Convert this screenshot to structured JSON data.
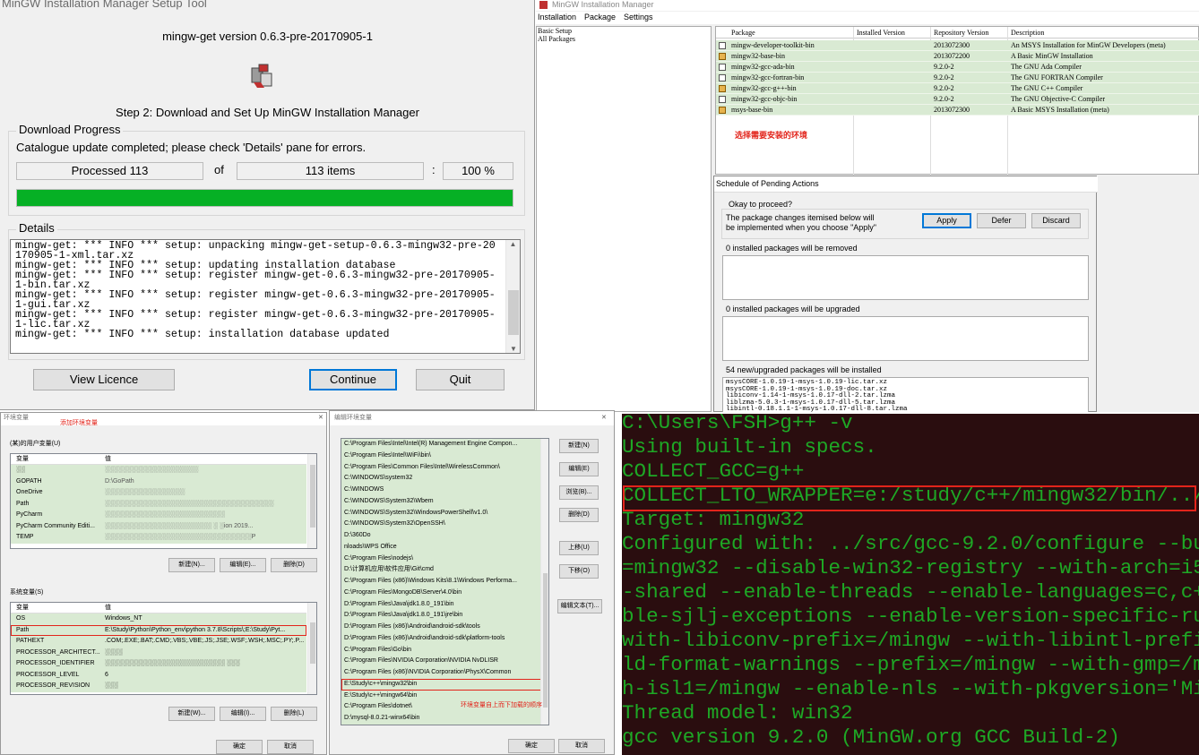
{
  "setup": {
    "title": "MinGW Installation Manager Setup Tool",
    "version": "mingw-get version 0.6.3-pre-20170905-1",
    "step": "Step 2: Download and Set Up MinGW Installation Manager",
    "download_group": "Download Progress",
    "status": "Catalogue update completed; please check 'Details' pane for errors.",
    "processed": "Processed 113",
    "of": "of",
    "items": "113 items",
    "colon": ":",
    "percent": "100 %",
    "progress_fraction": 1.0,
    "details_group": "Details",
    "details_text": "mingw-get: *** INFO *** setup: unpacking mingw-get-setup-0.6.3-mingw32-pre-20\n170905-1-xml.tar.xz\nmingw-get: *** INFO *** setup: updating installation database\nmingw-get: *** INFO *** setup: register mingw-get-0.6.3-mingw32-pre-20170905-\n1-bin.tar.xz\nmingw-get: *** INFO *** setup: register mingw-get-0.6.3-mingw32-pre-20170905-\n1-gui.tar.xz\nmingw-get: *** INFO *** setup: register mingw-get-0.6.3-mingw32-pre-20170905-\n1-lic.tar.xz\nmingw-get: *** INFO *** setup: installation database updated",
    "buttons": {
      "licence": "View Licence",
      "continue": "Continue",
      "quit": "Quit"
    },
    "progress_color": "#06b025"
  },
  "manager": {
    "title": "MinGW Installation Manager",
    "menu": [
      "Installation",
      "Package",
      "Settings"
    ],
    "tree": [
      "Basic Setup",
      "All Packages"
    ],
    "columns": [
      "Package",
      "Installed Version",
      "Repository Version",
      "Description"
    ],
    "packages": [
      {
        "name": "mingw-developer-toolkit-bin",
        "installed": "",
        "repo": "2013072300",
        "desc": "An MSYS Installation for MinGW Developers (meta)",
        "marked": false
      },
      {
        "name": "mingw32-base-bin",
        "installed": "",
        "repo": "2013072200",
        "desc": "A Basic MinGW Installation",
        "marked": true
      },
      {
        "name": "mingw32-gcc-ada-bin",
        "installed": "",
        "repo": "9.2.0-2",
        "desc": "The GNU Ada Compiler",
        "marked": false
      },
      {
        "name": "mingw32-gcc-fortran-bin",
        "installed": "",
        "repo": "9.2.0-2",
        "desc": "The GNU FORTRAN Compiler",
        "marked": false
      },
      {
        "name": "mingw32-gcc-g++-bin",
        "installed": "",
        "repo": "9.2.0-2",
        "desc": "The GNU C++ Compiler",
        "marked": true
      },
      {
        "name": "mingw32-gcc-objc-bin",
        "installed": "",
        "repo": "9.2.0-2",
        "desc": "The GNU Objective-C Compiler",
        "marked": false
      },
      {
        "name": "msys-base-bin",
        "installed": "",
        "repo": "2013072300",
        "desc": "A Basic MSYS Installation (meta)",
        "marked": true
      }
    ],
    "annotation": "选择需要安装的环境",
    "row_color": "#d9ead3",
    "annotation_color": "#e2241b"
  },
  "pending": {
    "title": "Schedule of Pending Actions",
    "okay_group": "Okay to proceed?",
    "msg_line1": "The package changes itemised below will",
    "msg_line2": "be implemented when you choose \"Apply\"",
    "buttons": {
      "apply": "Apply",
      "defer": "Defer",
      "discard": "Discard"
    },
    "removed": "0 installed packages will be removed",
    "upgraded": "0 installed packages will be upgraded",
    "installed": "54 new/upgraded packages will be installed",
    "install_list": [
      "msysCORE-1.0.19-1-msys-1.0.19-lic.tar.xz",
      "msysCORE-1.0.19-1-msys-1.0.19-doc.tar.xz",
      "libiconv-1.14-1-msys-1.0.17-dll-2.tar.lzma",
      "liblzma-5.0.3-1-msys-1.0.17-dll-5.tar.lzma",
      "libintl-0.18.1.1-1-msys-1.0.17-dll-8.tar.lzma"
    ]
  },
  "envvars": {
    "title": "环境变量",
    "annotation": "添加环境变量",
    "user_group": "(某)的用户变量(U)",
    "user_headers": [
      "变量",
      "值"
    ],
    "user_vars": [
      {
        "name": "░░",
        "value": "░░░░░░░░░░░░░░░░░░░░░"
      },
      {
        "name": "GOPATH",
        "value": "D:\\GoPath"
      },
      {
        "name": "OneDrive",
        "value": "░░░░░░░░░░░░░░░░░░"
      },
      {
        "name": "Path",
        "value": "░░░░░░░░░░░░░░░░░░░░░░░░░░░░░░░░░░░░░░"
      },
      {
        "name": "PyCharm",
        "value": "░░░░░░░░░░░░░░░░░░░░░░░░░░░"
      },
      {
        "name": "PyCharm Community Editi...",
        "value": "░░░░░░░░░░░░░░░░░░░░░░░░ ░ ░ion 2019..."
      },
      {
        "name": "TEMP",
        "value": "░░░░░░░░░░░░░░░░░░░░░░░░░░░░░░░░░P"
      }
    ],
    "user_buttons": [
      "新建(N)...",
      "编辑(E)...",
      "删除(D)"
    ],
    "system_group": "系统变量(S)",
    "sys_headers": [
      "变量",
      "值"
    ],
    "sys_vars": [
      {
        "name": "OS",
        "value": "Windows_NT",
        "hl": false
      },
      {
        "name": "Path",
        "value": "E:\\Study\\Python\\Python_env\\python 3.7.8\\Scripts\\;E:\\Study\\Pyt...",
        "hl": true
      },
      {
        "name": "PATHEXT",
        "value": ".COM;.EXE;.BAT;.CMD;.VBS;.VBE;.JS;.JSE;.WSF;.WSH;.MSC;.PY;.P...",
        "hl": false
      },
      {
        "name": "PROCESSOR_ARCHITECT...",
        "value": "░░░░",
        "hl": false
      },
      {
        "name": "PROCESSOR_IDENTIFIER",
        "value": "░░░░░░░░░░░░░░░░░░░░░░░░░░░ ░░░",
        "hl": false
      },
      {
        "name": "PROCESSOR_LEVEL",
        "value": "6",
        "hl": false
      },
      {
        "name": "PROCESSOR_REVISION",
        "value": "░░░",
        "hl": false
      }
    ],
    "sys_buttons": [
      "新建(W)...",
      "编辑(I)...",
      "删除(L)"
    ],
    "bottom_buttons": [
      "确定",
      "取消"
    ]
  },
  "editenv": {
    "title": "编辑环境变量",
    "paths": [
      "C:\\Program Files\\Intel\\Intel(R) Management Engine Compon...",
      "C:\\Program Files\\Intel\\WiFi\\bin\\",
      "C:\\Program Files\\Common Files\\Intel\\WirelessCommon\\",
      "C:\\WINDOWS\\system32",
      "C:\\WINDOWS",
      "C:\\WINDOWS\\System32\\Wbem",
      "C:\\WINDOWS\\System32\\WindowsPowerShell\\v1.0\\",
      "C:\\WINDOWS\\System32\\OpenSSH\\",
      "D:\\360Do",
      "nloads\\WPS Office",
      "C:\\Program Files\\nodejs\\",
      "D:\\计算机应用\\软件应用\\Git\\cmd",
      "C:\\Program Files (x86)\\Windows Kits\\8.1\\Windows Performa...",
      "C:\\Program Files\\MongoDB\\Server\\4.0\\bin",
      "D:\\Program Files\\Java\\jdk1.8.0_191\\bin",
      "D:\\Program Files\\Java\\jdk1.8.0_191\\jre\\bin",
      "D:\\Program Files (x86)\\Android\\android-sdk\\tools",
      "D:\\Program Files (x86)\\Android\\android-sdk\\platform-tools",
      "C:\\Program Files\\Go\\bin",
      "C:\\Program Files\\NVIDIA Corporation\\NVIDIA NvDLISR",
      "C:\\Program Files (x86)\\NVIDIA Corporation\\PhysX\\Common",
      "E:\\Study\\c++\\mingw32\\bin",
      "E:\\Study\\c++\\mingw64\\bin",
      "C:\\Program Files\\dotnet\\",
      "D:\\mysql-8.0.21-winx64\\bin"
    ],
    "highlight_index": 21,
    "buttons": [
      "新建(N)",
      "编辑(E)",
      "浏览(B)...",
      "删除(D)",
      "上移(U)",
      "下移(O)",
      "编辑文本(T)..."
    ],
    "annotation": "环境变量自上而下加载的顺序",
    "bottom_buttons": [
      "确定",
      "取消"
    ]
  },
  "console": {
    "lines": [
      "C:\\Users\\FSH>g++ -v",
      "Using built-in specs.",
      "COLLECT_GCC=g++",
      "COLLECT_LTO_WRAPPER=e:/study/c++/mingw32/bin/../",
      "Target: mingw32",
      "Configured with: ../src/gcc-9.2.0/configure --bu",
      "=mingw32 --disable-win32-registry --with-arch=i5",
      "-shared --enable-threads --enable-languages=c,c+",
      "ble-sjlj-exceptions --enable-version-specific-ru",
      "with-libiconv-prefix=/mingw --with-libintl-prefi",
      "ld-format-warnings --prefix=/mingw --with-gmp=/m",
      "h-isl1=/mingw --enable-nls --with-pkgversion='Min",
      "Thread model: win32",
      "gcc version 9.2.0 (MinGW.org GCC Build-2)"
    ],
    "highlight_index": 3,
    "text_color": "#1ea825",
    "bg_color": "#2a0d0f"
  }
}
